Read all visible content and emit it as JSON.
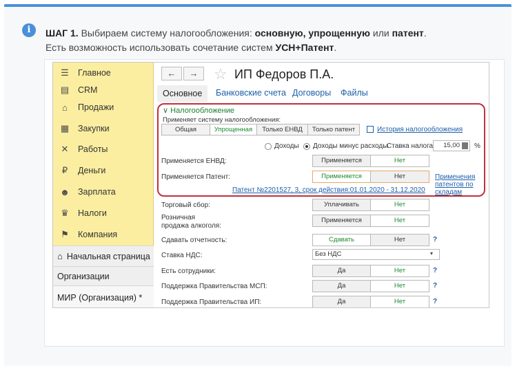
{
  "intro": {
    "step": "ШАГ 1.",
    "line1_text": "Выбираем систему налогообложения:",
    "opt1": "основную,",
    "opt2": "упрощенную",
    "or": "или",
    "opt3": "патент",
    "period": ".",
    "line2_text": "Есть возможность использовать сочетание систем",
    "line2_bold": "УСН+Патент",
    "line2_end": "."
  },
  "sidebar": {
    "items": [
      {
        "label": "Главное",
        "icon": "menu-icon"
      },
      {
        "label": "CRM",
        "icon": "id-card-icon"
      },
      {
        "label": "Продажи",
        "icon": "basket-icon"
      },
      {
        "label": "Закупки",
        "icon": "cart-icon"
      },
      {
        "label": "Работы",
        "icon": "tools-icon"
      },
      {
        "label": "Деньги",
        "icon": "ruble-icon"
      },
      {
        "label": "Зарплата",
        "icon": "people-icon"
      },
      {
        "label": "Налоги",
        "icon": "emblem-icon"
      },
      {
        "label": "Компания",
        "icon": "flag-icon"
      }
    ],
    "home": "Начальная страница",
    "orgs": "Организации",
    "current": "МИР (Организация) *"
  },
  "header": {
    "back": "←",
    "forward": "→",
    "star": "☆",
    "title": "ИП Федоров П.А."
  },
  "tabs": [
    "Основное",
    "Банковские счета",
    "Договоры",
    "Файлы"
  ],
  "tax": {
    "section": "Налогообложение",
    "applies_system": "Применяет систему налогообложения:",
    "systems": [
      "Общая",
      "Упрощенная",
      "Только ЕНВД",
      "Только патент"
    ],
    "history_link": "История налогообложения",
    "income": "Доходы",
    "income_minus": "Доходы минус расходы",
    "rate_label": "Ставка налога:",
    "rate_value": "15,00",
    "rate_unit": "%",
    "envd_label": "Применяется ЕНВД:",
    "patent_label": "Применяется Патент:",
    "applies": "Применяется",
    "no": "Нет",
    "warehouse_link": "Применения патентов по складам",
    "patent_link": "Патент №2201527, 3, срок действия:01.01.2020 - 31.12.2020"
  },
  "other": {
    "trade_fee": "Торговый сбор:",
    "pay": "Уплачивать",
    "no": "Нет",
    "alcohol1": "Розничная",
    "alcohol2": "продажа алкоголя:",
    "applies": "Применяется",
    "reporting": "Сдавать отчетность:",
    "submit": "Сдавать",
    "vat_label": "Ставка НДС:",
    "vat_value": "Без НДС",
    "employees": "Есть сотрудники:",
    "yes": "Да",
    "msp": "Поддержка Правительства МСП:",
    "ip": "Поддержка Правительства ИП:",
    "help": "?"
  },
  "colors": {
    "accent": "#4a90d9",
    "sidebar": "#fbeea0",
    "highlight": "#c0303a",
    "active": "#1a8a2e"
  }
}
